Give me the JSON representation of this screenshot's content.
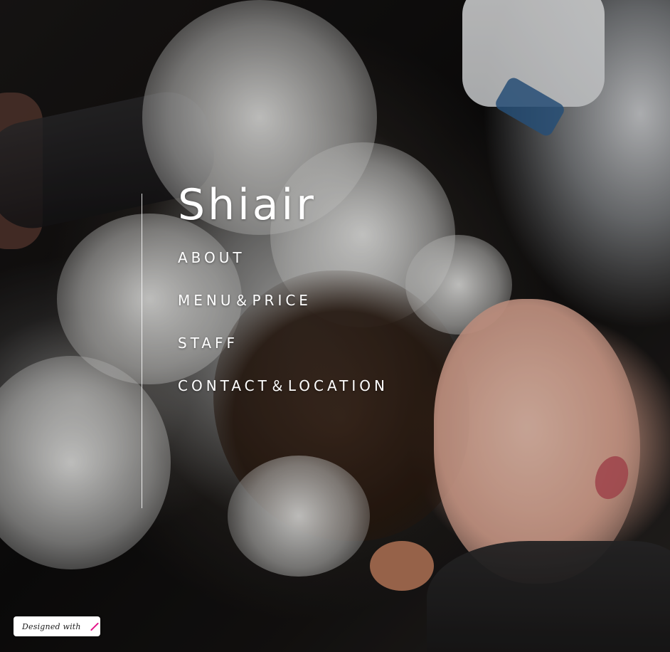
{
  "site": {
    "brand": "Shiair"
  },
  "nav": {
    "items": [
      {
        "label": "ABOUT"
      },
      {
        "label": "MENU＆PRICE"
      },
      {
        "label": "STAFF"
      },
      {
        "label": "CONTACT＆LOCATION"
      }
    ]
  },
  "badge": {
    "text": "Designed with",
    "icon": "pen-icon",
    "icon_color": "#e4138a"
  },
  "colors": {
    "text": "#ffffff",
    "accent": "#e4138a"
  }
}
